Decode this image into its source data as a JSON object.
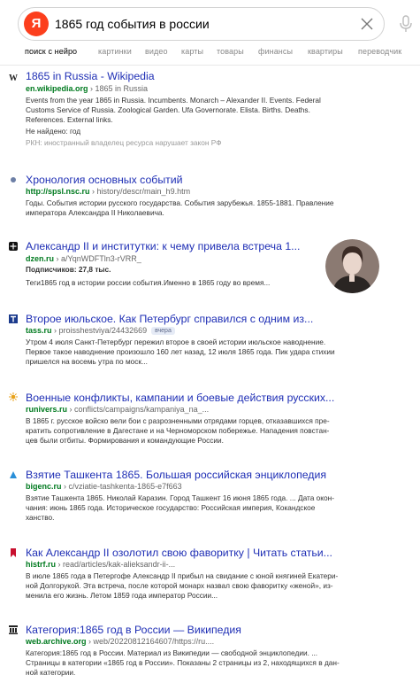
{
  "search": {
    "logo_letter": "Я",
    "query": "1865 год события в россии"
  },
  "tabs": [
    "поиск с нейро",
    "картинки",
    "видео",
    "карты",
    "товары",
    "финансы",
    "квартиры",
    "переводчик"
  ],
  "results": [
    {
      "title": "1865 in Russia - Wikipedia",
      "host": "en.wikipedia.org",
      "path": "› 1865 in Russia",
      "lines": [
        "Events from the year 1865 in Russia. Incumbents. Monarch – Alexander II. Events. Federal",
        "Customs Service of Russia. Zoological Garden. Ufa Governorate. Elista. Births. Deaths.",
        "References. External links.",
        "Не найдено: год",
        "РКН: иностранный владелец ресурса нарушает закон РФ"
      ]
    },
    {
      "title": "Хронология основных событий",
      "host": "http://spsl.nsc.ru",
      "path": "› history/descr/main_h9.htm",
      "lines": [
        "Годы. События истории русского государства. События зарубежья. 1855-1881. Правление",
        "императора Александра II Николаевича."
      ]
    },
    {
      "title": "Александр II и институтки: к чему привела встреча 1...",
      "host": "dzen.ru",
      "path": "› a/YqnWDFTln3-rVRR_",
      "subscribers": "Подписчиков: 27,8 тыс.",
      "lines": [
        "Теги1865 год в истории россии события.Именно в 1865 году во время..."
      ]
    },
    {
      "title": "Второе июльское. Как Петербург справился с одним из...",
      "host": "tass.ru",
      "path": "› proisshestviya/24432669",
      "badge": "вчера",
      "lines": [
        "Утром 4 июля Санкт-Петербург пережил второе в своей истории июльское наводнение.",
        "Первое такое наводнение произошло 160 лет назад, 12 июля 1865 года. Пик удара стихии",
        "пришелся на восемь утра по моск..."
      ]
    },
    {
      "title": "Военные конфликты, кампании и боевые действия русских...",
      "host": "runivers.ru",
      "path": "› conflicts/campaigns/kampaniya_na_...",
      "lines": [
        "В 1865 г. русское войско вели бои с разрозненными отрядами горцев, отказавшихся пре-",
        "кратить сопротивление в Дагестане и на Черноморском побережье. Нападения повстан-",
        "цев были отбиты. Формирования и командующие России."
      ]
    },
    {
      "title": "Взятие Ташкента 1865. Большая российская энциклопедия",
      "host": "bigenc.ru",
      "path": "› c/vziatie-tashkenta-1865-e7f663",
      "lines": [
        "Взятие Ташкента 1865. Николай Каразин. Город Ташкент 16 июня 1865 года. ... Дата окон-",
        "чания: июнь 1865 года. Историческое государство: Российская империя, Кокандское",
        "ханство."
      ]
    },
    {
      "title": "Как Александр II озолотил свою фаворитку | Читать статьи...",
      "host": "histrf.ru",
      "path": "› read/articles/kak-alieksandr-ii-...",
      "lines": [
        "В июле 1865 года в Петергофе Александр II прибыл на свидание с юной княгиней Екатери-",
        "ной Долгорукой. Эта встреча, после которой монарх назвал свою фаворитку «женой», из-",
        "менила его жизнь. Летом 1859 года император России..."
      ]
    },
    {
      "title": "Категория:1865 год в России — Википедия",
      "host": "web.archive.org",
      "path": "› web/20220812164607/https://ru....",
      "lines": [
        "Категория:1865 год в России. Материал из Википедии — свободной энциклопедии. ...",
        "Страницы в категории «1865 год в России». Показаны 2 страницы из 2, находящихся в дан-",
        "ной категории."
      ]
    }
  ]
}
